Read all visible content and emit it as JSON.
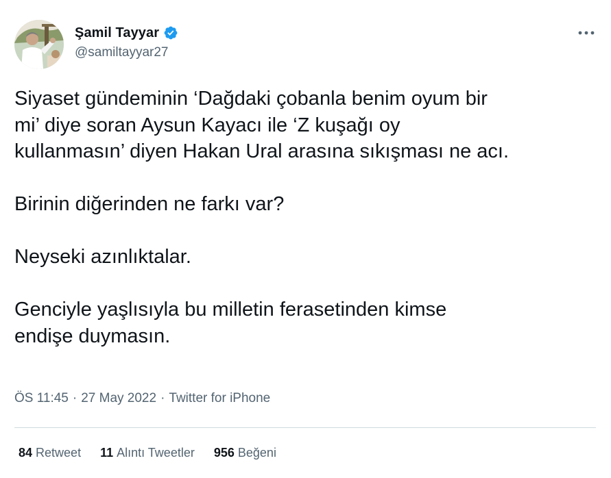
{
  "author": {
    "display_name": "Şamil Tayyar",
    "handle": "@samiltayyar27",
    "verified": true
  },
  "icons": {
    "verified": "verified-badge-icon",
    "more": "more-options-icon"
  },
  "tweet": {
    "paragraphs": [
      "Siyaset gündeminin ‘Dağdaki çobanla benim oyum bir\nmi’ diye soran Aysun Kayacı ile ‘Z kuşağı oy\nkullanmasın’ diyen Hakan Ural arasına sıkışması ne acı.",
      "Birinin diğerinden ne farkı var?",
      "Neyseki azınlıktalar.",
      "Genciyle yaşlısıyla bu milletin ferasetinden kimse\nendişe duymasın."
    ]
  },
  "meta": {
    "time": "ÖS 11:45",
    "date": "27 May 2022",
    "source": "Twitter for iPhone",
    "separator": "·"
  },
  "stats": {
    "retweets": {
      "count": "84",
      "label": "Retweet"
    },
    "quotes": {
      "count": "11",
      "label": "Alıntı Tweetler"
    },
    "likes": {
      "count": "956",
      "label": "Beğeni"
    }
  },
  "colors": {
    "text_primary": "#0f1419",
    "text_secondary": "#536471",
    "verified_blue": "#1d9bf0",
    "divider": "#cfd9de"
  }
}
